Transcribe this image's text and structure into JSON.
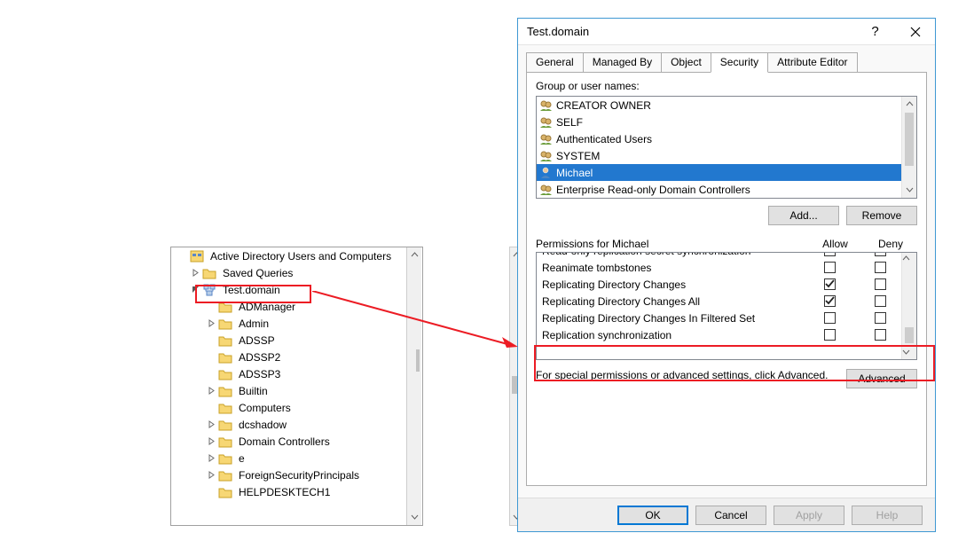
{
  "tree": {
    "root": "Active Directory Users and Computers",
    "domain": "Test.domain",
    "items": [
      {
        "label": "Saved Queries",
        "icon": "folder",
        "depth": 1,
        "expander": "closed"
      },
      {
        "label": "Test.domain",
        "icon": "domain",
        "depth": 1,
        "expander": "open",
        "highlight": true
      },
      {
        "label": "ADManager",
        "icon": "folder",
        "depth": 2,
        "expander": "none"
      },
      {
        "label": "Admin",
        "icon": "folder",
        "depth": 2,
        "expander": "closed"
      },
      {
        "label": "ADSSP",
        "icon": "folder",
        "depth": 2,
        "expander": "none"
      },
      {
        "label": "ADSSP2",
        "icon": "folder",
        "depth": 2,
        "expander": "none"
      },
      {
        "label": "ADSSP3",
        "icon": "folder",
        "depth": 2,
        "expander": "none"
      },
      {
        "label": "Builtin",
        "icon": "folder",
        "depth": 2,
        "expander": "closed"
      },
      {
        "label": "Computers",
        "icon": "folder",
        "depth": 2,
        "expander": "none"
      },
      {
        "label": "dcshadow",
        "icon": "folder",
        "depth": 2,
        "expander": "closed"
      },
      {
        "label": "Domain Controllers",
        "icon": "folder",
        "depth": 2,
        "expander": "closed"
      },
      {
        "label": "e",
        "icon": "folder",
        "depth": 2,
        "expander": "closed"
      },
      {
        "label": "ForeignSecurityPrincipals",
        "icon": "folder",
        "depth": 2,
        "expander": "closed"
      },
      {
        "label": "HELPDESKTECH1",
        "icon": "folder",
        "depth": 2,
        "expander": "none"
      }
    ]
  },
  "dialog": {
    "title": "Test.domain",
    "help_symbol": "?",
    "tabs": [
      "General",
      "Managed By",
      "Object",
      "Security",
      "Attribute Editor"
    ],
    "active_tab": 3,
    "groups_label": "Group or user names:",
    "principals": [
      {
        "name": "CREATOR OWNER",
        "type": "group"
      },
      {
        "name": "SELF",
        "type": "group"
      },
      {
        "name": "Authenticated Users",
        "type": "group"
      },
      {
        "name": "SYSTEM",
        "type": "group"
      },
      {
        "name": "Michael",
        "type": "user",
        "selected": true
      },
      {
        "name": "Enterprise Read-only Domain Controllers",
        "type": "group"
      }
    ],
    "add_label": "Add...",
    "remove_label": "Remove",
    "perm_title": "Permissions for Michael",
    "allow_label": "Allow",
    "deny_label": "Deny",
    "perms": [
      {
        "name": "Read-only replication secret synchronization",
        "allow": false,
        "deny": false,
        "cut": true
      },
      {
        "name": "Reanimate tombstones",
        "allow": false,
        "deny": false
      },
      {
        "name": "Replicating Directory Changes",
        "allow": true,
        "deny": false
      },
      {
        "name": "Replicating Directory Changes All",
        "allow": true,
        "deny": false
      },
      {
        "name": "Replicating Directory Changes In Filtered Set",
        "allow": false,
        "deny": false
      },
      {
        "name": "Replication synchronization",
        "allow": false,
        "deny": false
      }
    ],
    "adv_text": "For special permissions or advanced settings, click Advanced.",
    "advanced_label": "Advanced",
    "ok": "OK",
    "cancel": "Cancel",
    "apply": "Apply",
    "help": "Help"
  }
}
